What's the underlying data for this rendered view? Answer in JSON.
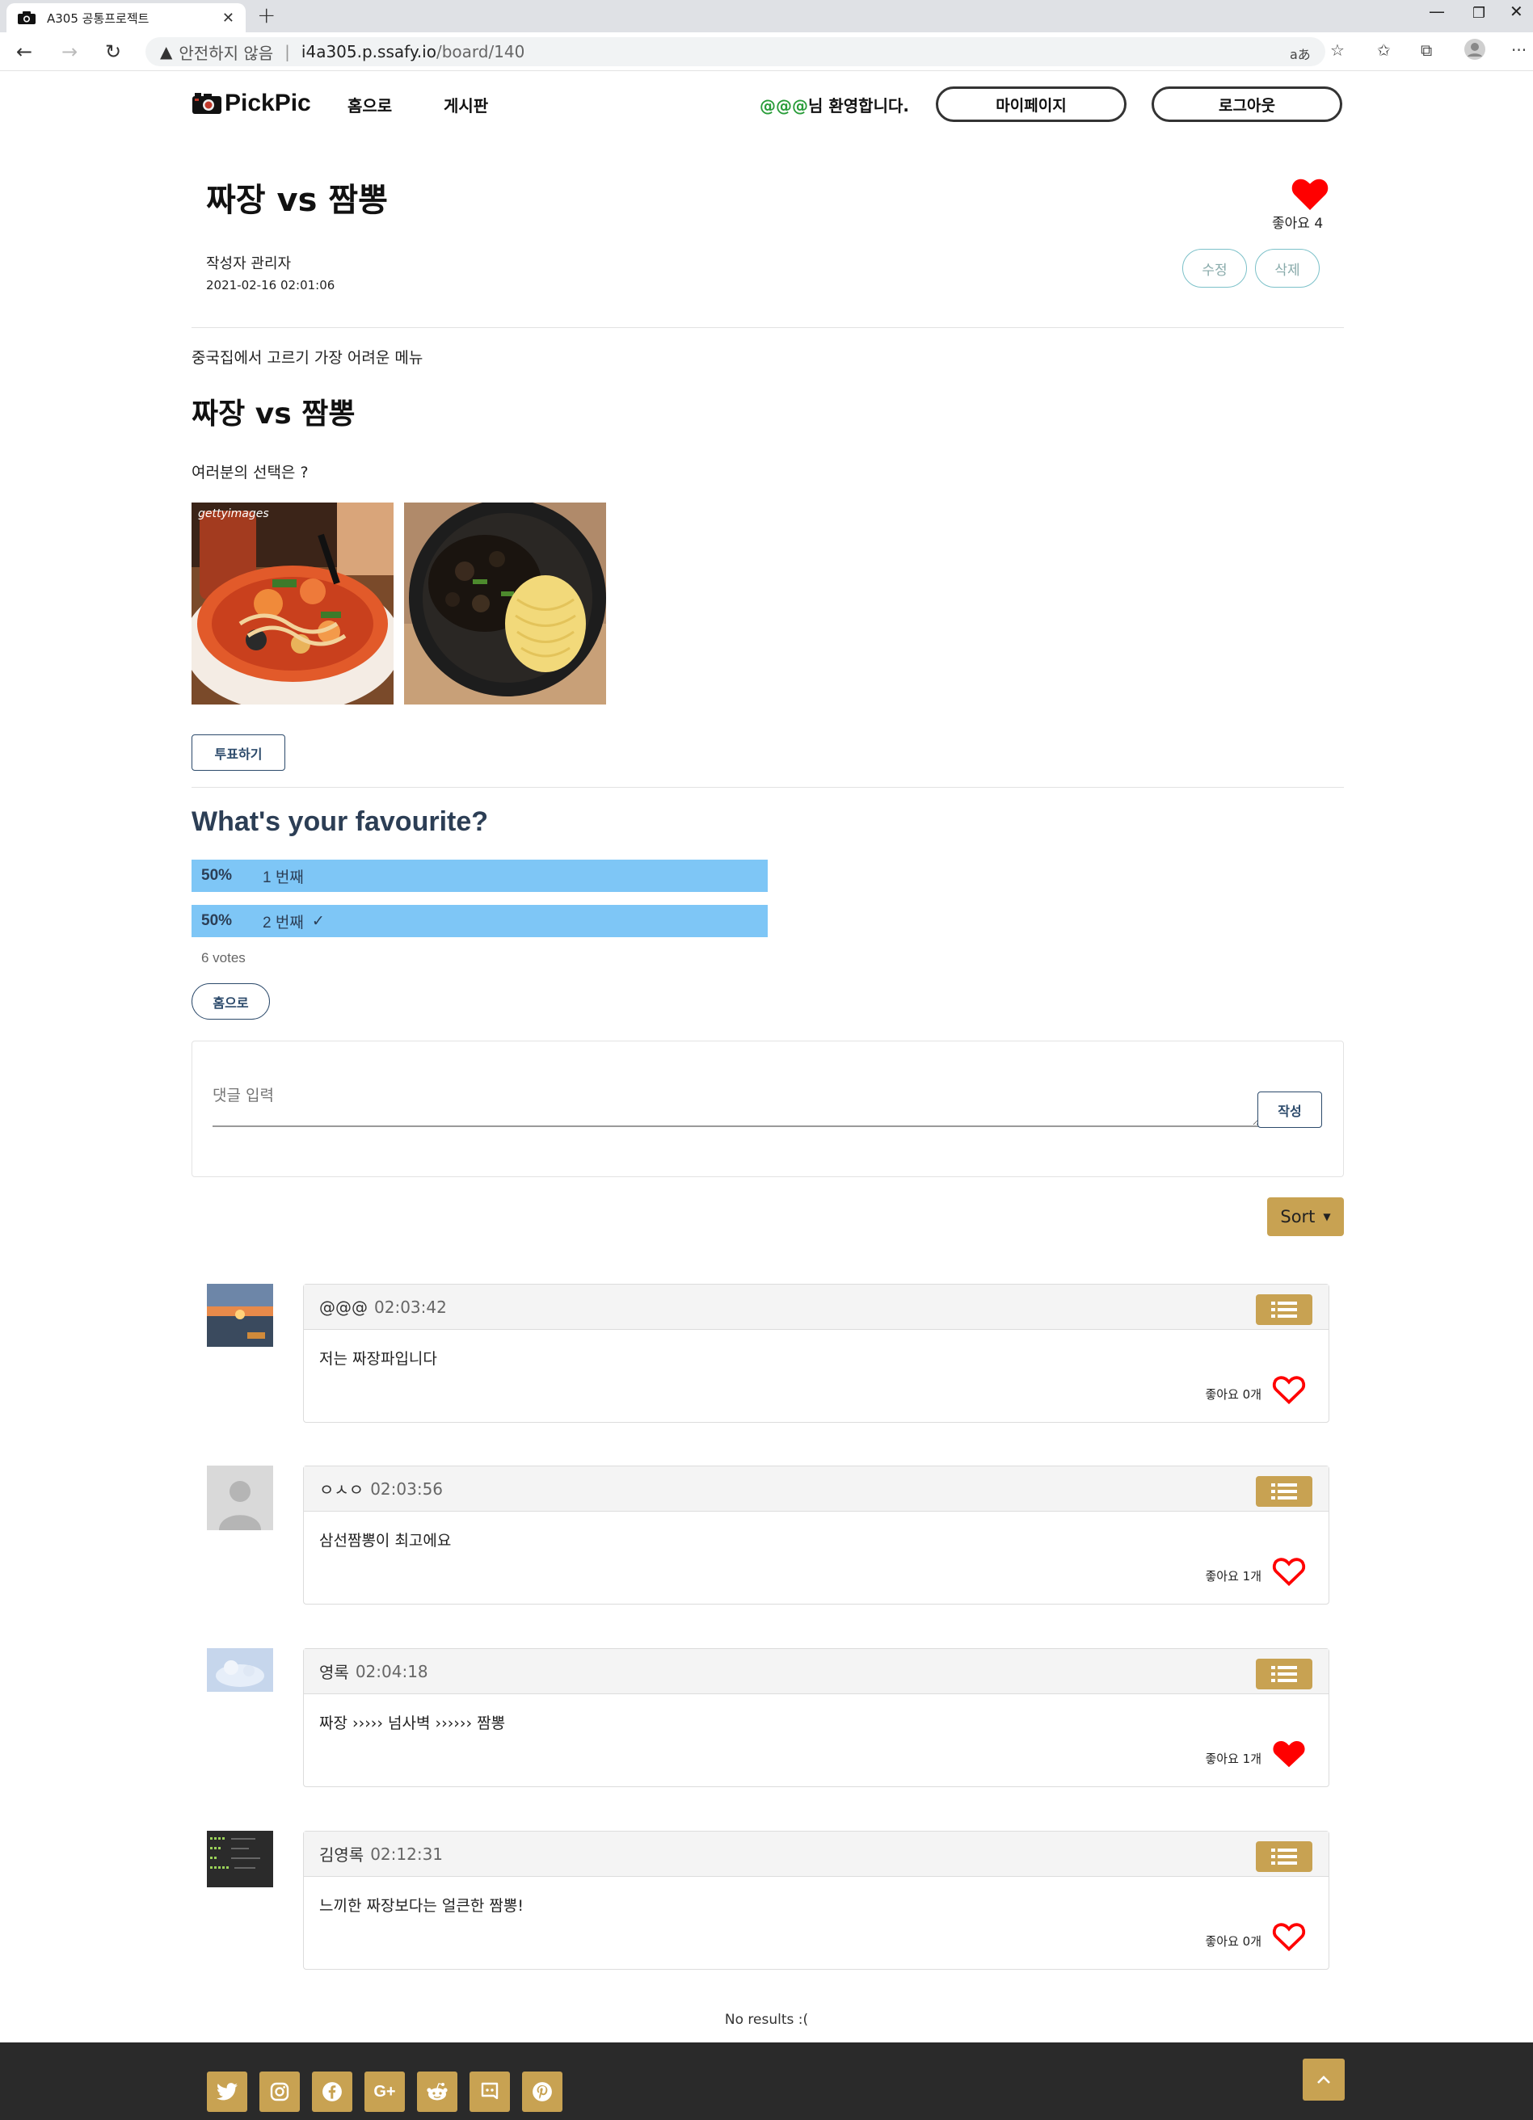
{
  "browser": {
    "tab_title": "A305 공통프로젝트",
    "tab_close": "✕",
    "new_tab": "+",
    "security_warning": "안전하지 않음",
    "url_host": "i4a305.p.ssafy.io",
    "url_path": "/board/140",
    "window_controls": {
      "minimize": "—",
      "restore": "❐",
      "close": "✕"
    },
    "more": "···"
  },
  "header": {
    "logo_text": "PickPic",
    "nav": {
      "home": "홈으로",
      "board": "게시판"
    },
    "welcome_nick": "@@@",
    "welcome_suffix": "님 환영합니다.",
    "mypage_label": "마이페이지",
    "logout_label": "로그아웃"
  },
  "post": {
    "title": "짜장 vs 짬뽕",
    "like_label": "좋아요 4",
    "author": "작성자 관리자",
    "date": "2021-02-16 02:01:06",
    "edit_label": "수정",
    "delete_label": "삭제",
    "intro": "중국집에서 고르기 가장 어려운 메뉴",
    "heading": "짜장 vs 짬뽕",
    "question": "여러분의 선택은 ?",
    "image_watermark": "gettyimages",
    "vote_button": "투표하기"
  },
  "poll": {
    "title": "What's your favourite?",
    "options": [
      {
        "pct": "50%",
        "label": "1 번째",
        "check": "",
        "fill": 1.0
      },
      {
        "pct": "50%",
        "label": "2 번째",
        "check": "✓",
        "fill": 1.0
      }
    ],
    "votes": "6 votes",
    "home_button": "홈으로"
  },
  "comment_form": {
    "placeholder": "댓글 입력",
    "submit_label": "작성",
    "sort_label": "Sort"
  },
  "comments": [
    {
      "author": "@@@",
      "time": "02:03:42",
      "text": "저는 짜장파입니다",
      "likes": "좋아요 0개",
      "liked": false
    },
    {
      "author": "ㅇㅅㅇ",
      "time": "02:03:56",
      "text": "삼선짬뽕이 최고에요",
      "likes": "좋아요 1개",
      "liked": false
    },
    {
      "author": "영록",
      "time": "02:04:18",
      "text": "짜장 ›››››  넘사벽 ››››››  짬뽕",
      "likes": "좋아요 1개",
      "liked": true
    },
    {
      "author": "김영록",
      "time": "02:12:31",
      "text": "느끼한 짜장보다는 얼큰한 짬뽕!",
      "likes": "좋아요 0개",
      "liked": false
    }
  ],
  "no_results": "No results :(",
  "footer": {
    "social_icons": [
      "twitter-icon",
      "instagram-icon",
      "facebook-icon",
      "google-plus-icon",
      "reddit-icon",
      "discord-icon",
      "pinterest-icon"
    ]
  },
  "colors": {
    "accent_gold": "#c8a252",
    "poll_bar": "#7ec6f6",
    "heart_red": "#ff0000",
    "nick_green": "#2a9d3a"
  }
}
